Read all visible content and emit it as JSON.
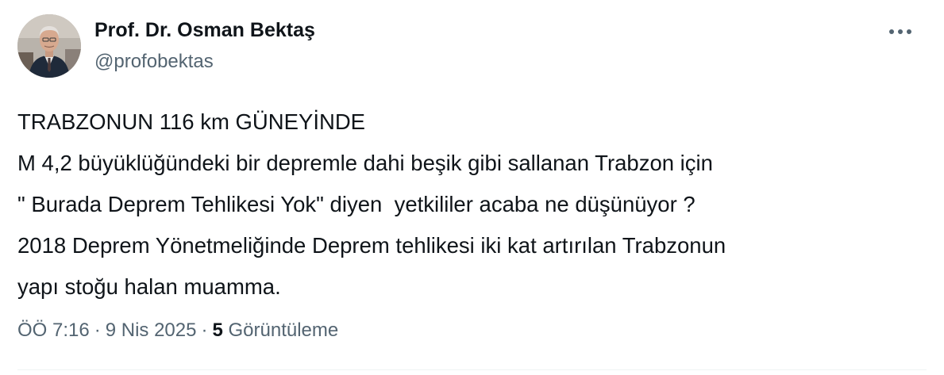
{
  "author": {
    "display_name": "Prof. Dr. Osman Bektaş",
    "handle": "@profobektas"
  },
  "tweet": {
    "lines": [
      "TRABZONUN 116 km GÜNEYİNDE",
      "M 4,2 büyüklüğündeki bir depremle dahi beşik gibi sallanan Trabzon için",
      "\" Burada Deprem Tehlikesi Yok\" diyen  yetkililer acaba ne düşünüyor ?",
      "2018 Deprem Yönetmeliğinde Deprem tehlikesi iki kat artırılan Trabzonun",
      "yapı stoğu halan muamma."
    ]
  },
  "meta": {
    "time": "ÖÖ 7:16",
    "separator": "·",
    "date": "9 Nis 2025",
    "views_count": "5",
    "views_label": "Görüntüleme"
  },
  "icons": {
    "more": "more-horizontal-icon"
  },
  "colors": {
    "primary_text": "#0f1419",
    "secondary_text": "#536471",
    "divider": "#eff3f4",
    "background": "#ffffff"
  }
}
